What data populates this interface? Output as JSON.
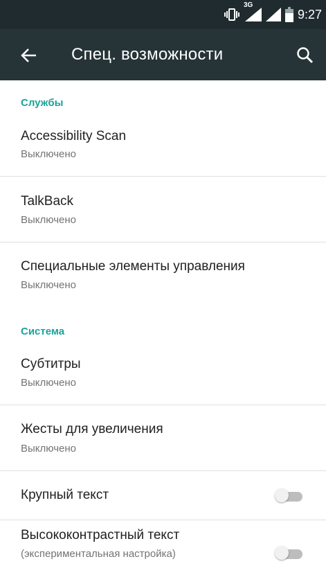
{
  "status_bar": {
    "network": "3G",
    "time": "9:27"
  },
  "toolbar": {
    "title": "Спец. возможности"
  },
  "sections": [
    {
      "header": "Службы",
      "items": [
        {
          "title": "Accessibility Scan",
          "subtitle": "Выключено"
        },
        {
          "title": "TalkBack",
          "subtitle": "Выключено"
        },
        {
          "title": "Специальные элементы управления",
          "subtitle": "Выключено"
        }
      ]
    },
    {
      "header": "Система",
      "items": [
        {
          "title": "Субтитры",
          "subtitle": "Выключено"
        },
        {
          "title": "Жесты для увеличения",
          "subtitle": "Выключено"
        },
        {
          "title": "Крупный текст",
          "toggle": false
        },
        {
          "title": "Высококонтрастный текст",
          "subtitle": "(экспериментальная настройка)",
          "toggle": false
        }
      ]
    }
  ],
  "colors": {
    "status_bar": "#1f2b2f",
    "toolbar": "#263438",
    "accent": "#1aa39a",
    "divider": "#e0e0e0"
  },
  "icons": {
    "back": "arrow-back-icon",
    "search": "search-icon",
    "vibrate": "vibrate-icon",
    "signal": "signal-icon",
    "battery": "battery-icon"
  }
}
